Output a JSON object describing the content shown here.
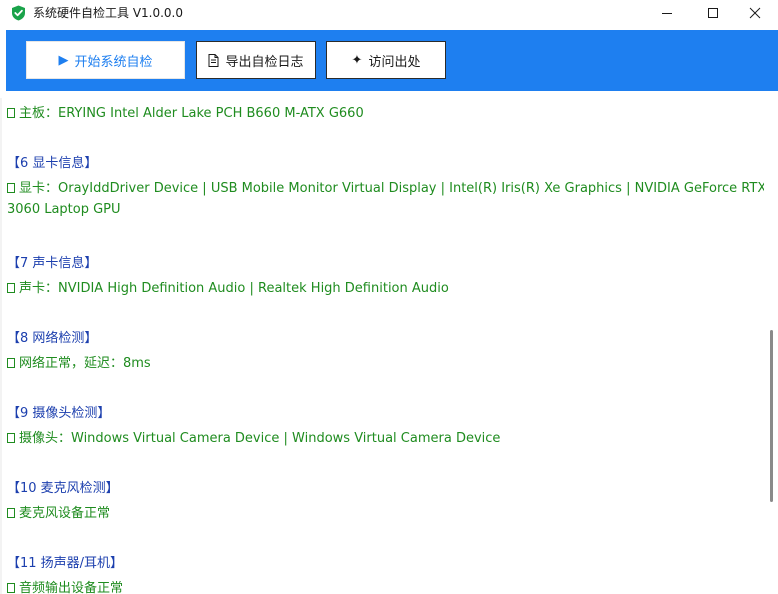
{
  "window": {
    "title": "系统硬件自检工具 V1.0.0.0",
    "icon": "shield-check-icon",
    "controls": [
      "minimize-icon",
      "maximize-icon",
      "close-icon"
    ]
  },
  "toolbar": {
    "background": "#1e7ff0",
    "start_label": "开始系统自检",
    "start_icon": "▶",
    "export_label": "导出自检日志",
    "export_icon": "document-icon",
    "visit_label": "访问出处",
    "visit_icon": "✦"
  },
  "log": {
    "lines": [
      {
        "kind": "ok",
        "text": "主板：ERYING Intel Alder Lake PCH B660 M-ATX G660"
      },
      {
        "kind": "head",
        "text": "【6 显卡信息】"
      },
      {
        "kind": "ok",
        "text": "显卡：OrayIddDriver Device | USB Mobile Monitor Virtual Display | Intel(R) Iris(R) Xe Graphics | NVIDIA GeForce RTX"
      },
      {
        "kind": "cont",
        "text": "3060 Laptop GPU"
      },
      {
        "kind": "head",
        "text": "【7 声卡信息】"
      },
      {
        "kind": "ok",
        "text": "声卡：NVIDIA High Definition Audio | Realtek High Definition Audio"
      },
      {
        "kind": "head",
        "text": "【8 网络检测】"
      },
      {
        "kind": "ok",
        "text": "网络正常，延迟：8ms"
      },
      {
        "kind": "head",
        "text": "【9 摄像头检测】"
      },
      {
        "kind": "ok",
        "text": "摄像头：Windows Virtual Camera Device | Windows Virtual Camera Device"
      },
      {
        "kind": "head",
        "text": "【10 麦克风检测】"
      },
      {
        "kind": "ok",
        "text": "麦克风设备正常"
      },
      {
        "kind": "head",
        "text": "【11 扬声器/耳机】"
      },
      {
        "kind": "ok",
        "text": "音频输出设备正常"
      }
    ]
  },
  "colors": {
    "ok_text": "#1f8c1f",
    "heading_text": "#1c3fae"
  }
}
